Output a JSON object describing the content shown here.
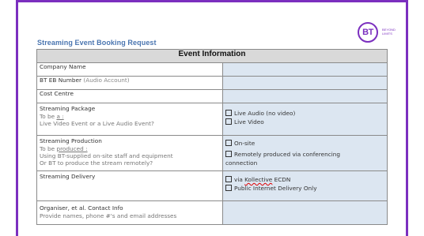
{
  "title": "Streaming Event Booking Request",
  "logo": {
    "mark": "BT",
    "tagline_1": "BEYOND",
    "tagline_2": "LIMITS"
  },
  "section_header": "Event Information",
  "rows": {
    "company": {
      "label": "Company Name"
    },
    "eb": {
      "label": "BT EB Number",
      "hint": "(Audio Account)"
    },
    "cost": {
      "label": "Cost Centre"
    },
    "package": {
      "label": "Streaming Package",
      "line2_pre": "To be ",
      "line2_link": "a :",
      "line3": "Live Video Event or a Live Audio Event?",
      "options": [
        "Live Audio (no video)",
        "Live Video"
      ]
    },
    "production": {
      "label": "Streaming Production",
      "line2_pre": "To be ",
      "line2_link": "produced :",
      "line3": "Using BT-supplied on-site staff and equipment",
      "line4": "Or BT to produce the stream remotely?",
      "options": [
        "On-site",
        "Remotely produced via conferencing",
        "connection"
      ]
    },
    "delivery": {
      "label": "Streaming Delivery",
      "option1_pre": "via ",
      "option1_brand": "Kollective",
      "option1_post": " ECDN",
      "option2": "Public Internet Delivery Only"
    },
    "organiser": {
      "label": "Organiser, et al. Contact Info",
      "hint": "Provide names, phone #'s and email addresses"
    }
  }
}
